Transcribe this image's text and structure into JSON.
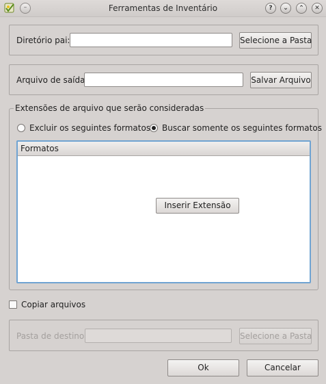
{
  "window": {
    "title": "Ferramentas de Inventário",
    "controls": {
      "help": "?",
      "minimize": "⌄",
      "maximize": "⌃",
      "close": "✕"
    },
    "menu_glyph": "–"
  },
  "parent_dir": {
    "label": "Diretório pai:",
    "value": "",
    "button": "Selecione a Pasta"
  },
  "output_file": {
    "label": "Arquivo de saída:",
    "value": "",
    "button": "Salvar Arquivo"
  },
  "extensions": {
    "group_title": "Extensões de arquivo que serão consideradas",
    "exclude_option": "Excluir os seguintes formatos",
    "only_option": "Buscar somente os seguintes formatos",
    "selected_option": "only",
    "table_header": "Formatos",
    "insert_button": "Inserir Extensão"
  },
  "copy_files": {
    "label": "Copiar arquivos",
    "checked": false
  },
  "destination": {
    "label": "Pasta de destino:",
    "value": "",
    "button": "Selecione a Pasta",
    "enabled": false
  },
  "footer": {
    "ok": "Ok",
    "cancel": "Cancelar"
  },
  "colors": {
    "window_bg": "#d6d2d0",
    "focus_border": "#6fa3d2",
    "disabled_text": "#a4a09e"
  }
}
